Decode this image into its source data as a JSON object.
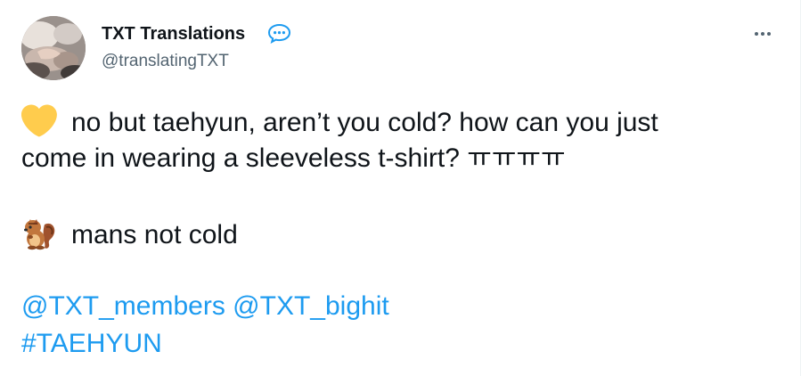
{
  "tweet": {
    "author": {
      "display_name": "TXT Translations",
      "handle": "@translatingTXT",
      "verified_icon": "speech-bubble-badge-icon",
      "avatar_icon": "avatar-hands-photo"
    },
    "more_icon": "more-options-icon",
    "lines": {
      "line1_emoji": "yellow-heart-icon",
      "line1_text": "no but taehyun, aren’t you cold? how can you just",
      "line2_text": "come in wearing a sleeveless t-shirt? ㅠㅠㅠㅠ",
      "line3_emoji": "chipmunk-icon",
      "line3_text": "mans not cold"
    },
    "mentions": [
      "@TXT_members",
      "@TXT_bighit"
    ],
    "hashtag": "#TAEHYUN"
  },
  "colors": {
    "text": "#0f1419",
    "secondary_text": "#536471",
    "link": "#1d9bf0",
    "badge": "#1d9bf0",
    "heart": "#ffcc4d"
  }
}
